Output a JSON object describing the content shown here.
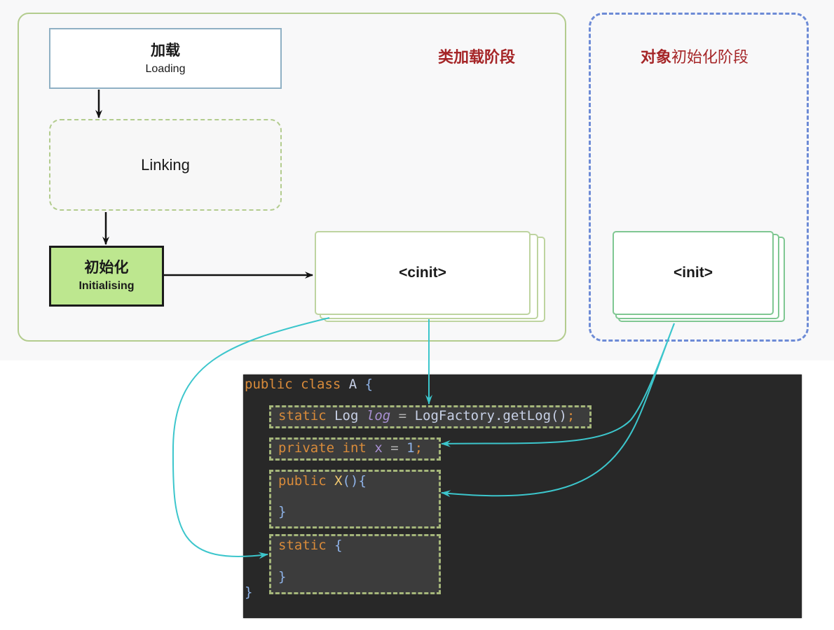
{
  "phases": {
    "class_loading": {
      "title": "类加载阶段"
    },
    "object_init": {
      "title_bold": "对象",
      "title_rest": "初始化阶段"
    }
  },
  "steps": {
    "loading": {
      "zh": "加载",
      "en": "Loading"
    },
    "linking": {
      "en": "Linking"
    },
    "initialising": {
      "zh": "初始化",
      "en": "Initialising"
    }
  },
  "methods": {
    "cinit": "<cinit>",
    "init": "<init>"
  },
  "code": {
    "line1": {
      "kw1": "public",
      "kw2": "class",
      "name": "A",
      "brace": "{"
    },
    "static_field": {
      "kw": "static",
      "type": "Log",
      "var": "log",
      "eq": "=",
      "expr": "LogFactory.getLog()",
      "semi": ";"
    },
    "instance_field": {
      "kw1": "private",
      "kw2": "int",
      "var": "x",
      "eq": "=",
      "value": "1",
      "semi": ";"
    },
    "constructor": {
      "kw": "public",
      "name": "X",
      "parens": "()",
      "open": "{",
      "close": "}"
    },
    "static_block": {
      "kw": "static",
      "open": "{",
      "close": "}"
    },
    "class_close": "}"
  },
  "colors": {
    "phase_title": "#a52527",
    "class_phase_border": "#b3cc8e",
    "object_phase_border": "#6d8bd6",
    "connector": "#3cc6cc",
    "init_fill": "#bde78f",
    "code_bg": "#282828",
    "code_keyword": "#d98b3a"
  }
}
